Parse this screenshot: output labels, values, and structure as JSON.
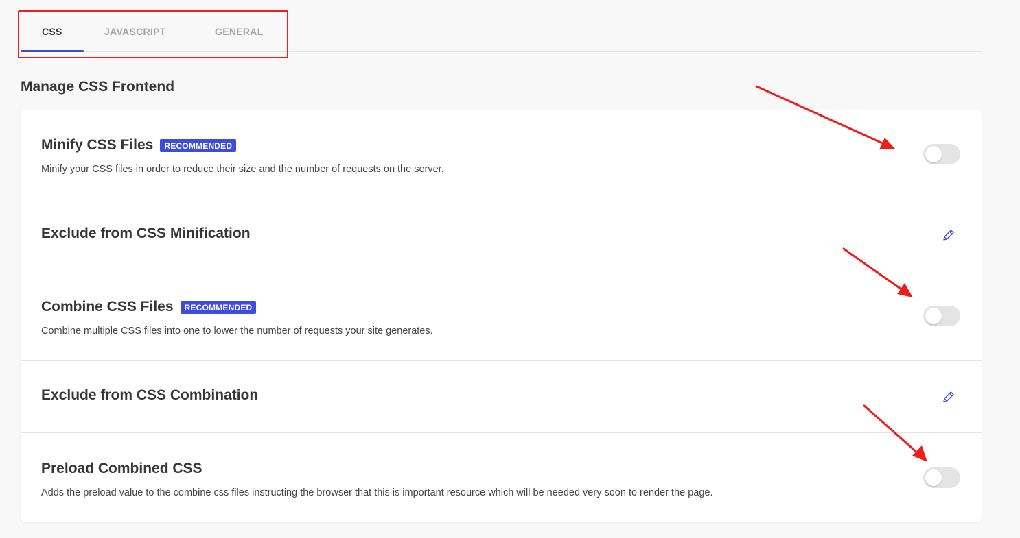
{
  "tabs": [
    {
      "label": "CSS",
      "active": true
    },
    {
      "label": "JAVASCRIPT",
      "active": false
    },
    {
      "label": "GENERAL",
      "active": false
    }
  ],
  "section_title": "Manage CSS Frontend",
  "rows": [
    {
      "title": "Minify CSS Files",
      "badge": "RECOMMENDED",
      "description": "Minify your CSS files in order to reduce their size and the number of requests on the server.",
      "control": "toggle",
      "enabled": false
    },
    {
      "title": "Exclude from CSS Minification",
      "control": "edit",
      "icon": "pencil-icon"
    },
    {
      "title": "Combine CSS Files",
      "badge": "RECOMMENDED",
      "description": "Combine multiple CSS files into one to lower the number of requests your site generates.",
      "control": "toggle",
      "enabled": false
    },
    {
      "title": "Exclude from CSS Combination",
      "control": "edit",
      "icon": "pencil-icon"
    },
    {
      "title": "Preload Combined CSS",
      "description": "Adds the preload value to the combine css files instructing the browser that this is important resource which will be needed very soon to render the page.",
      "control": "toggle",
      "enabled": false
    }
  ],
  "colors": {
    "accent": "#3e4bdb",
    "annotation": "#f01d1d",
    "toggle_off": "#e4e4e4",
    "background": "#f8f8f8"
  }
}
